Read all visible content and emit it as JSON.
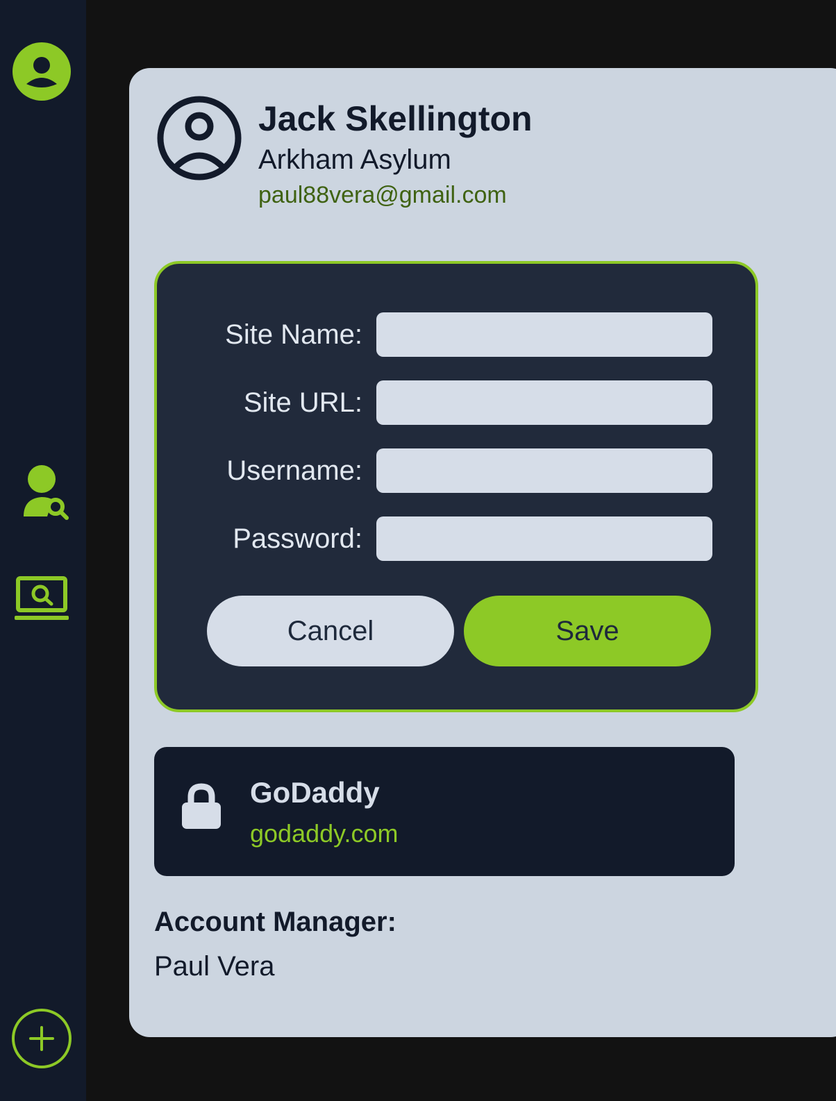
{
  "sidebar": {
    "icons": [
      "user-circle-icon",
      "user-search-icon",
      "laptop-search-icon",
      "add-circle-icon"
    ],
    "accent": "#8dc926"
  },
  "profile": {
    "name": "Jack Skellington",
    "organization": "Arkham Asylum",
    "email": "paul88vera@gmail.com"
  },
  "form": {
    "site_name_label": "Site Name:",
    "site_name_value": "",
    "site_url_label": "Site URL:",
    "site_url_value": "",
    "username_label": "Username:",
    "username_value": "",
    "password_label": "Password:",
    "password_value": "",
    "cancel_label": "Cancel",
    "save_label": "Save"
  },
  "site_entry": {
    "icon": "lock-icon",
    "name": "GoDaddy",
    "url": "godaddy.com"
  },
  "account_manager": {
    "label": "Account Manager:",
    "value": "Paul Vera"
  },
  "colors": {
    "accent": "#8dc926",
    "sidebar_bg": "#121a2a",
    "panel_bg": "#ccd5e0",
    "form_bg": "#212a3b",
    "email_text": "#3f6212"
  }
}
